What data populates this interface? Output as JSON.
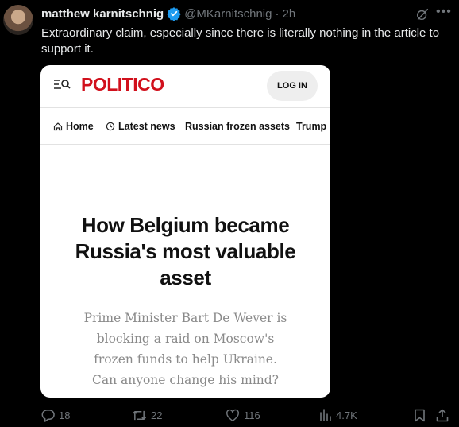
{
  "tweet": {
    "author_name": "matthew karnitschnig",
    "handle": "@MKarnitschnig",
    "separator": "·",
    "time": "2h",
    "text": "Extraordinary claim, especially since there is literally nothing in the article to support it."
  },
  "card": {
    "logo": "POLITICO",
    "login_label": "LOG IN",
    "nav": [
      {
        "label": "Home",
        "icon": "home-icon"
      },
      {
        "label": "Latest news",
        "icon": "clock-icon"
      },
      {
        "label": "Russian frozen assets"
      },
      {
        "label": "Trump"
      }
    ],
    "headline": "How Belgium became Russia's most valuable asset",
    "dek": "Prime Minister Bart De Wever is blocking a raid on Moscow's frozen funds to help Ukraine. Can anyone change his mind?"
  },
  "actions": {
    "replies": "18",
    "reposts": "22",
    "likes": "116",
    "views": "4.7K"
  },
  "colors": {
    "background": "#000000",
    "text": "#e7e9ea",
    "muted": "#71767b",
    "verified": "#1d9bf0",
    "politico_red": "#d1101c"
  }
}
